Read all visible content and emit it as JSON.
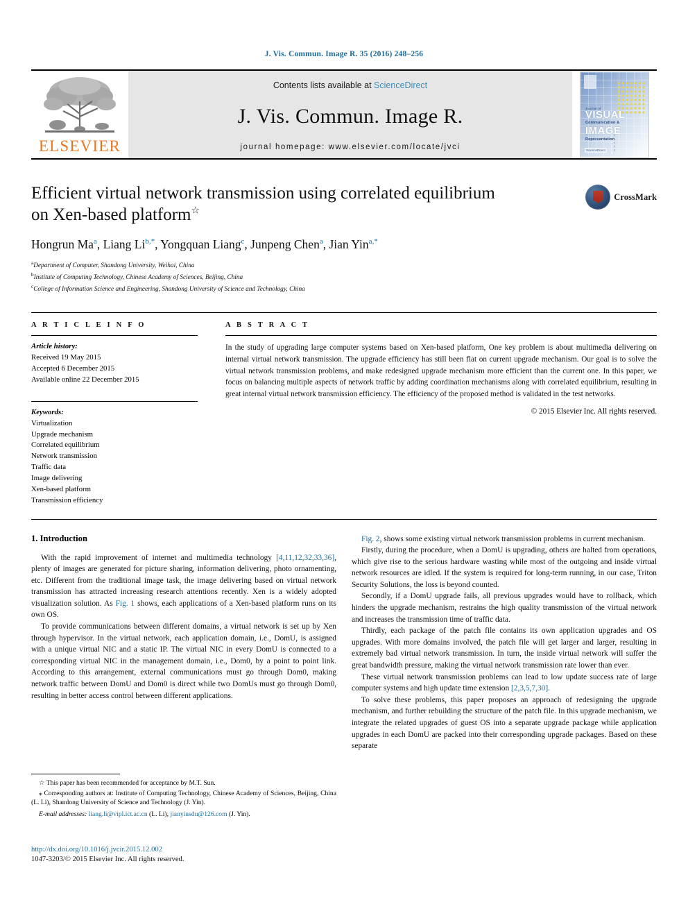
{
  "running_head": "J. Vis. Commun. Image R. 35 (2016) 248–256",
  "masthead": {
    "publisher_name": "ELSEVIER",
    "contents_prefix": "Contents lists available at ",
    "sciencedirect": "ScienceDirect",
    "journal_title": "J. Vis. Commun. Image R.",
    "homepage": "journal homepage: www.elsevier.com/locate/jvci",
    "cover": {
      "kicker": "Journal of",
      "line1": "VISUAL",
      "sub1": "Communication &",
      "line2": "IMAGE",
      "sub2": "Representation",
      "foot": "ScienceDirect"
    }
  },
  "title": {
    "line1": "Efficient virtual network transmission using correlated equilibrium",
    "line2": "on Xen-based platform",
    "footnote_mark": "☆"
  },
  "crossmark": {
    "label": "CrossMark"
  },
  "authors": [
    {
      "name": "Hongrun Ma",
      "sup": "a",
      "asterisk": ""
    },
    {
      "name": "Liang Li",
      "sup": "b",
      "asterisk": ",*"
    },
    {
      "name": "Yongquan Liang",
      "sup": "c",
      "asterisk": ""
    },
    {
      "name": "Junpeng Chen",
      "sup": "a",
      "asterisk": ""
    },
    {
      "name": "Jian Yin",
      "sup": "a",
      "asterisk": ",*"
    }
  ],
  "affiliations": [
    {
      "mark": "a",
      "text": "Department of Computer, Shandong University, Weihai, China"
    },
    {
      "mark": "b",
      "text": "Institute of Computing Technology, Chinese Academy of Sciences, Beijing, China"
    },
    {
      "mark": "c",
      "text": "College of Information Science and Engineering, Shandong University of Science and Technology, China"
    }
  ],
  "article_info": {
    "heading": "A R T I C L E  I N F O",
    "history_title": "Article history:",
    "history": [
      "Received 19 May 2015",
      "Accepted 6 December 2015",
      "Available online 22 December 2015"
    ],
    "keywords_title": "Keywords:",
    "keywords": [
      "Virtualization",
      "Upgrade mechanism",
      "Correlated equilibrium",
      "Network transmission",
      "Traffic data",
      "Image delivering",
      "Xen-based platform",
      "Transmission efficiency"
    ]
  },
  "abstract": {
    "heading": "A B S T R A C T",
    "text": "In the study of upgrading large computer systems based on Xen-based platform, One key problem is about multimedia delivering on internal virtual network transmission. The upgrade efficiency has still been flat on current upgrade mechanism. Our goal is to solve the virtual network transmission problems, and make redesigned upgrade mechanism more efficient than the current one. In this paper, we focus on balancing multiple aspects of network traffic by adding coordination mechanisms along with correlated equilibrium, resulting in great internal virtual network transmission efficiency. The efficiency of the proposed method is validated in the test networks.",
    "copyright": "© 2015 Elsevier Inc. All rights reserved."
  },
  "body": {
    "section_title": "1. Introduction",
    "left_paragraphs": [
      "With the rapid improvement of internet and multimedia technology [4,11,12,32,33,36], plenty of images are generated for picture sharing, information delivering, photo ornamenting, etc. Different from the traditional image task, the image delivering based on virtual network transmission has attracted increasing research attentions recently. Xen is a widely adopted visualization solution. As Fig. 1 shows, each applications of a Xen-based platform runs on its own OS.",
      "To provide communications between different domains, a virtual network is set up by Xen through hypervisor. In the virtual network, each application domain, i.e., DomU, is assigned with a unique virtual NIC and a static IP. The virtual NIC in every DomU is connected to a corresponding virtual NIC in the management domain, i.e., Dom0, by a point to point link. According to this arrangement, external communications must go through Dom0, making network traffic between DomU and Dom0 is direct while two DomUs must go through Dom0, resulting in better access control between different applications."
    ],
    "right_paragraphs": [
      "Fig. 2, shows some existing virtual network transmission problems in current mechanism.",
      "Firstly, during the procedure, when a DomU is upgrading, others are halted from operations, which give rise to the serious hardware wasting while most of the outgoing and inside virtual network resources are idled. If the system is required for long-term running, in our case, Triton Security Solutions, the loss is beyond counted.",
      "Secondly, if a DomU upgrade fails, all previous upgrades would have to rollback, which hinders the upgrade mechanism, restrains the high quality transmission of the virtual network and increases the transmission time of traffic data.",
      "Thirdly, each package of the patch file contains its own application upgrades and OS upgrades. With more domains involved, the patch file will get larger and larger, resulting in extremely bad virtual network transmission. In turn, the inside virtual network will suffer the great bandwidth pressure, making the virtual network transmission rate lower than ever.",
      "These virtual network transmission problems can lead to low update success rate of large computer systems and high update time extension [2,3,5,7,30].",
      "To solve these problems, this paper proposes an approach of redesigning the upgrade mechanism, and further rebuilding the structure of the patch file. In this upgrade mechanism, we integrate the related upgrades of guest OS into a separate upgrade package while application upgrades in each DomU are packed into their corresponding upgrade packages. Based on these separate"
    ],
    "links": {
      "ref_1": "[4,11,12,32,33,36]",
      "fig_1": "Fig. 1",
      "fig_2": "Fig. 2",
      "ref_2": "[2,3,5,7,30]"
    }
  },
  "footnotes": {
    "star_note": "☆ This paper has been recommended for acceptance by M.T. Sun.",
    "corresponding_note": "⁎ Corresponding authors at: Institute of Computing Technology, Chinese Academy of Sciences, Beijing, China (L. Li), Shandong University of Science and Technology (J. Yin).",
    "email_label": "E-mail addresses:",
    "email_1": "liang.li@vipl.ict.ac.cn",
    "email_1_who": "(L. Li),",
    "email_2": "jianyinsdu@126.com",
    "email_2_who": "(J. Yin)."
  },
  "footer": {
    "doi": "http://dx.doi.org/10.1016/j.jvcir.2015.12.002",
    "issn_copyright": "1047-3203/© 2015 Elsevier Inc. All rights reserved."
  },
  "colors": {
    "link_blue": "#1a6c9c",
    "sciencedirect_blue": "#3d8eba",
    "elsevier_orange": "#E87722",
    "masthead_gray": "#e6e6e6"
  }
}
